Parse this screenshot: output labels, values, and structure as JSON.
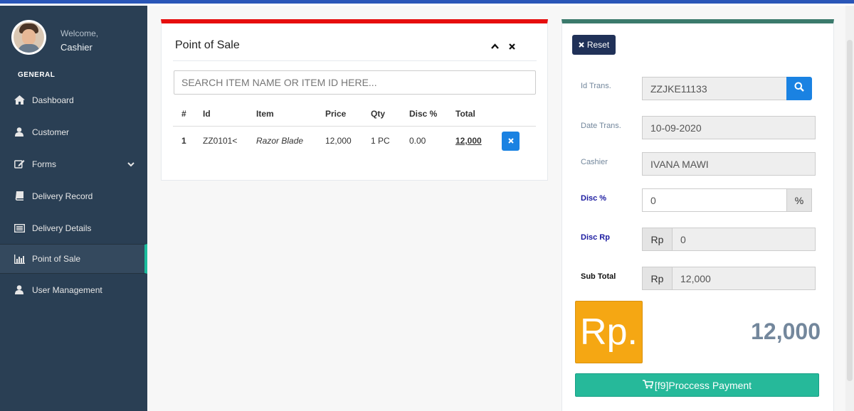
{
  "sidebar": {
    "welcome": "Welcome,",
    "username": "Cashier",
    "section_title": "GENERAL",
    "items": [
      {
        "label": "Dashboard",
        "icon": "home-icon"
      },
      {
        "label": "Customer",
        "icon": "user-icon"
      },
      {
        "label": "Forms",
        "icon": "edit-icon",
        "has_submenu": true
      },
      {
        "label": "Delivery Record",
        "icon": "book-icon"
      },
      {
        "label": "Delivery Details",
        "icon": "list-icon"
      },
      {
        "label": "Point of Sale",
        "icon": "bar-chart-icon",
        "active": true
      },
      {
        "label": "User Management",
        "icon": "user-icon"
      }
    ]
  },
  "pos": {
    "title": "Point of Sale",
    "search_placeholder": "SEARCH ITEM NAME OR ITEM ID HERE...",
    "columns": [
      "#",
      "Id",
      "Item",
      "Price",
      "Qty",
      "Disc %",
      "Total"
    ],
    "rows": [
      {
        "num": "1",
        "id": "ZZ0101<",
        "item": "Razor Blade",
        "price": "12,000",
        "qty": "1 PC",
        "disc": "0.00",
        "total": "12,000"
      }
    ]
  },
  "transaction": {
    "reset_label": "Reset",
    "id_label": "Id Trans.",
    "id_value": "ZZJKE11133",
    "date_label": "Date Trans.",
    "date_value": "10-09-2020",
    "cashier_label": "Cashier",
    "cashier_value": "IVANA MAWI",
    "disc_pct_label": "Disc %",
    "disc_pct_value": "0",
    "disc_pct_addon": "%",
    "disc_rp_label": "Disc Rp",
    "disc_rp_addon": "Rp",
    "disc_rp_value": "0",
    "subtotal_label": "Sub Total",
    "subtotal_addon": "Rp",
    "subtotal_value": "12,000",
    "currency_badge": "Rp.",
    "grand_total": "12,000",
    "pay_label": "[f9]Proccess Payment"
  },
  "colors": {
    "sidebar_bg": "#2a3f54",
    "pos_panel_accent": "#e60e0e",
    "trans_panel_accent": "#3b7a6c",
    "primary_blue": "#1a82e2",
    "reset_button": "#203158",
    "currency_badge": "#f5a713",
    "pay_button": "#26b99a"
  }
}
